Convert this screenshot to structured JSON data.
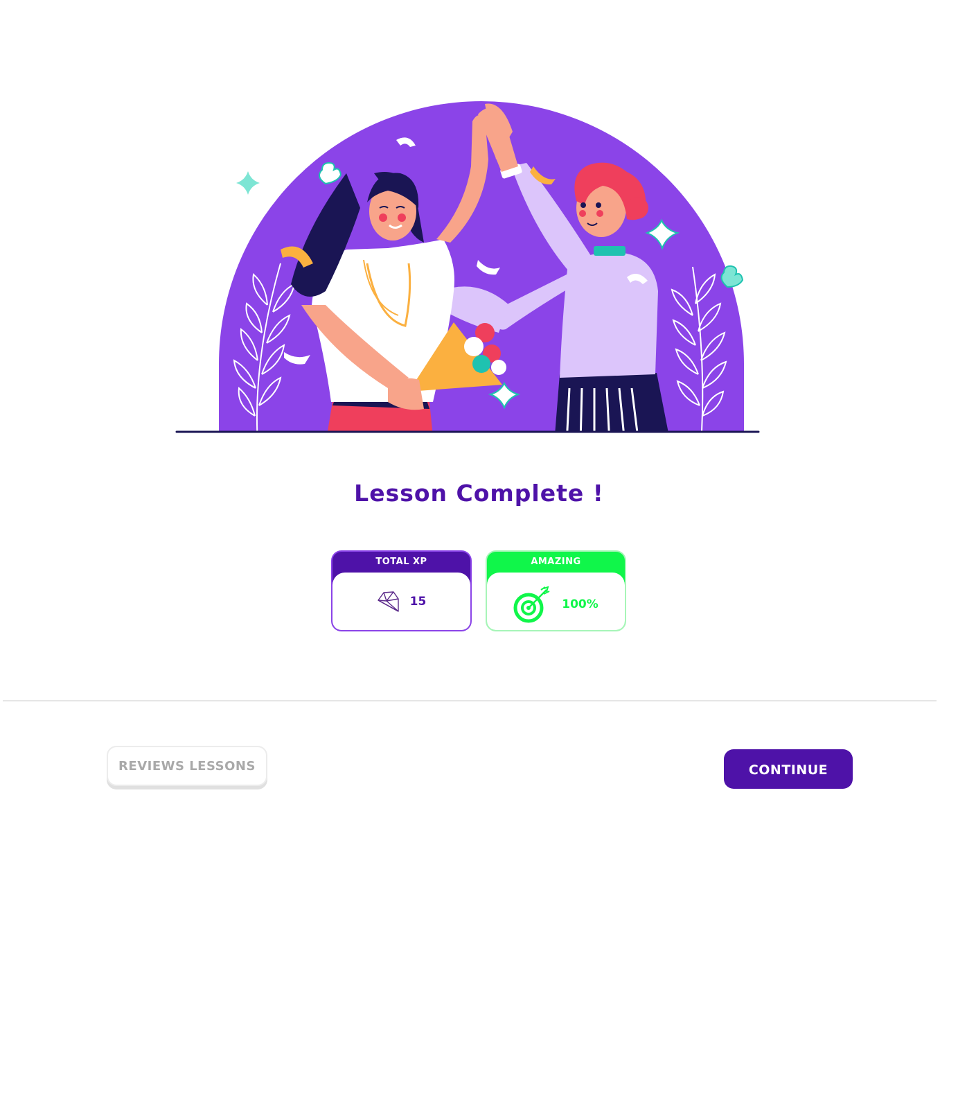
{
  "title": "Lesson Complete !",
  "stats": [
    {
      "label": "TOTAL XP",
      "value": "15",
      "icon": "diamond-icon",
      "color": "#4e12a8"
    },
    {
      "label": "AMAZING",
      "value": "100%",
      "icon": "target-icon",
      "color": "#10f64a"
    }
  ],
  "buttons": {
    "secondary": "REVIEWS LESSONS",
    "primary": "CONTINUE"
  },
  "colors": {
    "brand_purple": "#4e12a8",
    "illustration_purple": "#8b44e8",
    "success_green": "#10f64a",
    "muted_text": "#a9a9a9"
  },
  "illustration": {
    "name": "celebration-high-five",
    "decor_icons": [
      "heart-icon",
      "sparkle-icon",
      "confetti-icon",
      "bouquet-icon",
      "fern-icon"
    ]
  }
}
